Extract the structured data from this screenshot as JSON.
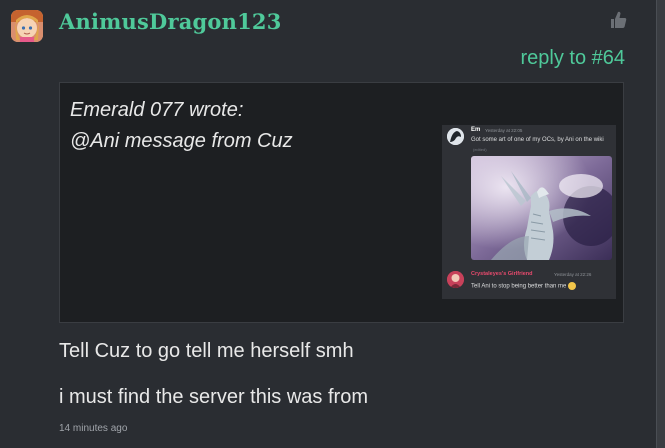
{
  "post": {
    "username": "AnimusDragon123",
    "reply_to": "reply to #64",
    "quote": {
      "author": "Emerald 077 wrote:",
      "text": "@Ani message from Cuz",
      "screenshot": {
        "message1": {
          "name": "Em",
          "time": "Yesterday at 22:05",
          "text": "Got some art of one of my OCs, by Ani on the wiki",
          "edited": "(edited)"
        },
        "message2": {
          "name": "CrystaIeyes's Girlfriend",
          "time": "Yesterday at 22:26",
          "text": "Tell Ani to stop being better than me"
        }
      }
    },
    "body": [
      "Tell Cuz to go tell me herself smh",
      "i must find the server this was from"
    ],
    "timestamp": "14 minutes ago"
  },
  "colors": {
    "background": "#2a2d32",
    "accent": "#4fc99a",
    "quote_bg": "#1d1f22",
    "discord_bg": "#2f3136",
    "discord_name_pink": "#e84a6d"
  },
  "icons": [
    "thumbs-up-icon",
    "user-avatar",
    "discord-avatar"
  ]
}
